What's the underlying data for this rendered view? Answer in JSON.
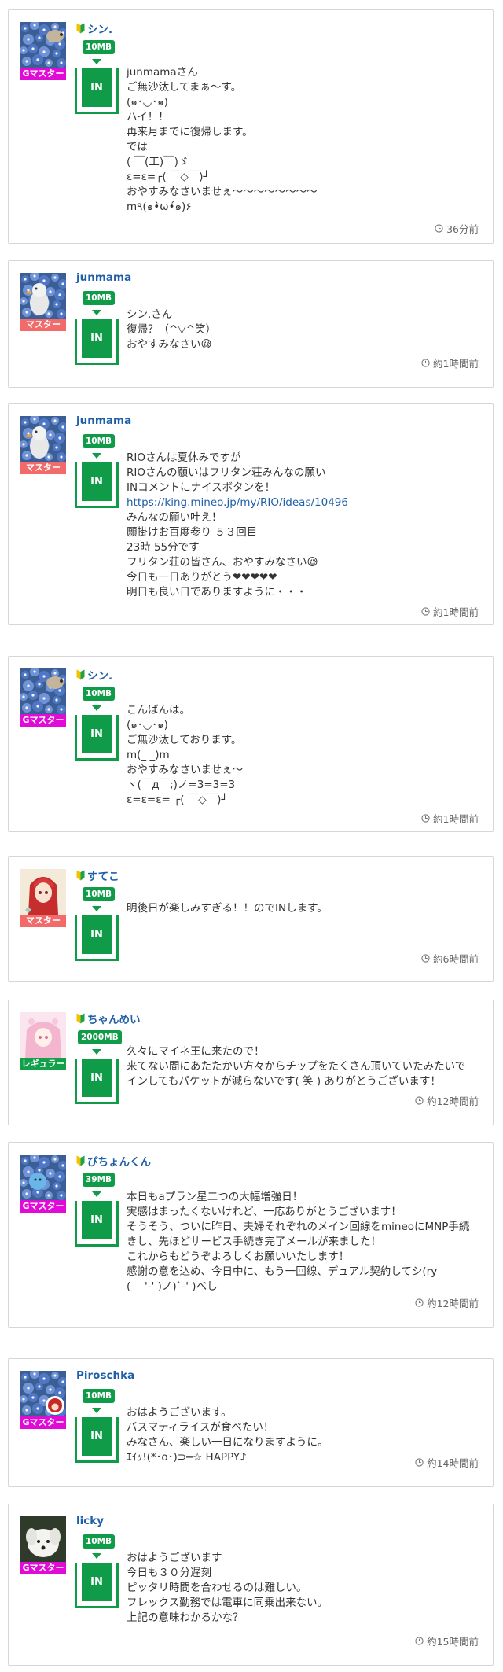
{
  "posts": [
    {
      "user": "シン.",
      "beginner": true,
      "rank": "Gマスター",
      "rank_class": "g",
      "avatar": "blue-flowers-hedgehog",
      "capacity": "10MB",
      "in_label": "IN",
      "message": "junmamaさん\nご無沙汰してまぁ～す。\n(๑･◡･๑)\nハイ！！\n再来月までに復帰します。\nでは\n( ￣(工)￣)ゞ\nε=ε=┌( ￣◇￣)┘\nおやすみなさいませぇ～～～～～～～～\nm٩(๑•̀ω•́๑)۶",
      "time": "36分前"
    },
    {
      "user": "junmama",
      "beginner": false,
      "rank": "マスター",
      "rank_class": "m",
      "avatar": "blue-flowers-bird",
      "capacity": "10MB",
      "in_label": "IN",
      "message": "シン.さん\n復帰？（^▽^笑）\nおやすみなさい😪",
      "time": "約1時間前"
    },
    {
      "user": "junmama",
      "beginner": false,
      "rank": "マスター",
      "rank_class": "m",
      "avatar": "blue-flowers-bird",
      "capacity": "10MB",
      "in_label": "IN",
      "message_before_link": "RIOさんは夏休みですが\nRIOさんの願いはフリタン荘みんなの願い\nINコメントにナイスボタンを！\n",
      "link": "https://king.mineo.jp/my/RIO/ideas/10496",
      "message_after_link": "\nみんなの願い叶え！\n願掛けお百度参り ５３回目\n23時 55分です\nフリタン荘の皆さん、おやすみなさい😪\n今日も一日ありがとう❤❤❤❤❤\n明日も良い日でありますように・・・",
      "time": "約1時間前"
    },
    {
      "user": "シン.",
      "beginner": true,
      "rank": "Gマスター",
      "rank_class": "g",
      "avatar": "blue-flowers-hedgehog",
      "capacity": "10MB",
      "in_label": "IN",
      "message": "こんばんは。\n(๑･◡･๑)\nご無沙汰しております。\nm(_ _)m\nおやすみなさいませぇ～\nヽ(￣д￣;)ノ=3=3=3\nε=ε=ε= ┌( ￣◇￣)┘",
      "time": "約1時間前"
    },
    {
      "user": "すてこ",
      "beginner": true,
      "rank": "マスター",
      "rank_class": "m",
      "avatar": "anime-girl-red-hair",
      "capacity": "10MB",
      "in_label": "IN",
      "message": "明後日が楽しみすぎる！！のでINします。",
      "time": "約6時間前"
    },
    {
      "user": "ちゃんめい",
      "beginner": true,
      "rank": "レギュラー",
      "rank_class": "r",
      "avatar": "anime-girl-pink",
      "capacity": "2000MB",
      "in_label": "IN",
      "message": "久々にマイネ王に来たので！\n来てない間にあたたかい方々からチップをたくさん頂いていたみたいで インしてもパケットが減らないです( 笑 ) ありがとうございます！",
      "time": "約12時間前"
    },
    {
      "user": "ぴちょんくん",
      "beginner": true,
      "rank": "Gマスター",
      "rank_class": "g",
      "avatar": "blue-flowers-mascot",
      "capacity": "39MB",
      "in_label": "IN",
      "message": "本日もaプラン星二つの大幅増強日！\n実感はまったくないけれど、一応ありがとうございます！\nそうそう、ついに昨日、夫婦それぞれのメイン回線をmineoにMNP手続きし、先ほどサービス手続き完了メールが来ました！\nこれからもどうぞよろしくお願いいたします！\n感謝の意を込め、今日中に、もう一回線、デュアル契約してシ(ry\n(　 '-' )ノ)`-' )べし",
      "time": "約12時間前"
    },
    {
      "user": "Piroschka",
      "beginner": false,
      "rank": "Gマスター",
      "rank_class": "g",
      "avatar": "blue-flowers-redhood",
      "capacity": "10MB",
      "in_label": "IN",
      "message": "おはようございます。\nバスマティライスが食べたい！\nみなさん、楽しい一日になりますように。\nｴｲｯ!(*･o･)⊃━☆ HAPPY♪",
      "time": "約14時間前"
    },
    {
      "user": "licky",
      "beginner": false,
      "rank": "Gマスター",
      "rank_class": "g",
      "avatar": "white-dog",
      "capacity": "10MB",
      "in_label": "IN",
      "message": "おはようございます\n今日も３０分遅刻\nピッタリ時間を合わせるのは難しい。\nフレックス勤務では電車に同乗出来ない。\n上記の意味わかるかな？",
      "time": "約15時間前"
    }
  ]
}
